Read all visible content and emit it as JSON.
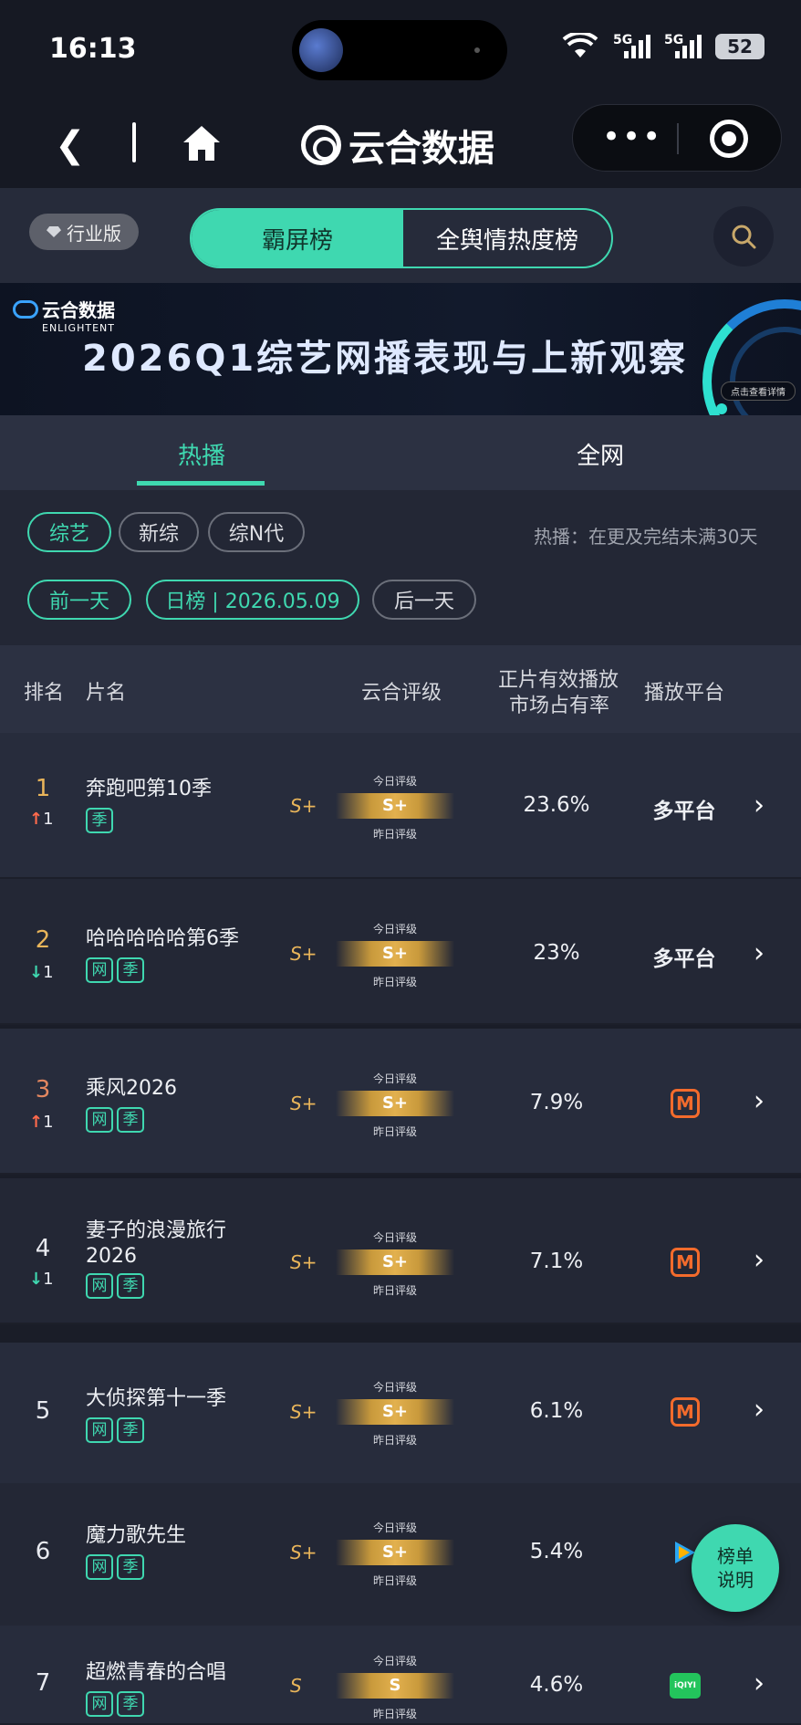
{
  "status_bar": {
    "time": "16:13",
    "network1": "5G",
    "network2": "5G",
    "battery": "52"
  },
  "nav": {
    "brand": "云合数据"
  },
  "toolbar": {
    "edition": "行业版",
    "tab_active": "霸屏榜",
    "tab_other": "全舆情热度榜"
  },
  "banner": {
    "logo_cn": "云合数据",
    "logo_en": "ENLIGHTENT",
    "title": "2026Q1综艺网播表现与上新观察",
    "detail": "点击查看详情"
  },
  "tabs": {
    "hot": "热播",
    "all": "全网"
  },
  "filters": {
    "category": [
      "综艺",
      "新综",
      "综N代"
    ],
    "hint": "热播：在更及完结未满30天",
    "prev": "前一天",
    "date": "日榜 | 2026.05.09",
    "next": "后一天"
  },
  "table_header": {
    "rank": "排名",
    "name": "片名",
    "grade": "云合评级",
    "share_l1": "正片有效播放",
    "share_l2": "市场占有率",
    "platform": "播放平台"
  },
  "grade_caption_top": "今日评级",
  "grade_caption_bottom": "昨日评级",
  "rows": [
    {
      "rank": "1",
      "delta_dir": "up",
      "delta_arrow": "↑",
      "delta_val": "1",
      "title": "奔跑吧第10季",
      "tags": [
        "季"
      ],
      "grade_prev": "S+",
      "grade_today": "S+",
      "share": "23.6%",
      "platform": "多平台"
    },
    {
      "rank": "2",
      "delta_dir": "down",
      "delta_arrow": "↓",
      "delta_val": "1",
      "title": "哈哈哈哈哈第6季",
      "tags": [
        "网",
        "季"
      ],
      "grade_prev": "S+",
      "grade_today": "S+",
      "share": "23%",
      "platform": "多平台"
    },
    {
      "rank": "3",
      "delta_dir": "up",
      "delta_arrow": "↑",
      "delta_val": "1",
      "title": "乘风2026",
      "tags": [
        "网",
        "季"
      ],
      "grade_prev": "S+",
      "grade_today": "S+",
      "share": "7.9%",
      "platform_icon": "mango-tv-icon"
    },
    {
      "rank": "4",
      "delta_dir": "down",
      "delta_arrow": "↓",
      "delta_val": "1",
      "title_l1": "妻子的浪漫旅行",
      "title_l2": "2026",
      "tags": [
        "网",
        "季"
      ],
      "grade_prev": "S+",
      "grade_today": "S+",
      "share": "7.1%",
      "platform_icon": "mango-tv-icon"
    },
    {
      "rank": "5",
      "title": "大侦探第十一季",
      "tags": [
        "网",
        "季"
      ],
      "grade_prev": "S+",
      "grade_today": "S+",
      "share": "6.1%",
      "platform_icon": "mango-tv-icon"
    },
    {
      "rank": "6",
      "title": "魔力歌先生",
      "tags": [
        "网",
        "季"
      ],
      "grade_prev": "S+",
      "grade_today": "S+",
      "share": "5.4%",
      "platform_icon": "tencent-video-icon"
    },
    {
      "rank": "7",
      "title": "超燃青春的合唱",
      "tags": [
        "网",
        "季"
      ],
      "grade_prev": "S",
      "grade_today": "S",
      "share": "4.6%",
      "platform_icon": "iqiyi-icon",
      "platform_icon_text": "iQIYI"
    }
  ],
  "float_button": {
    "l1": "榜单",
    "l2": "说明"
  },
  "colors": {
    "accent": "#3fd8b0",
    "gold": "#e9b55a",
    "up": "#ff6a4c",
    "mango": "#f36b2c",
    "iqiyi": "#23c45c"
  }
}
